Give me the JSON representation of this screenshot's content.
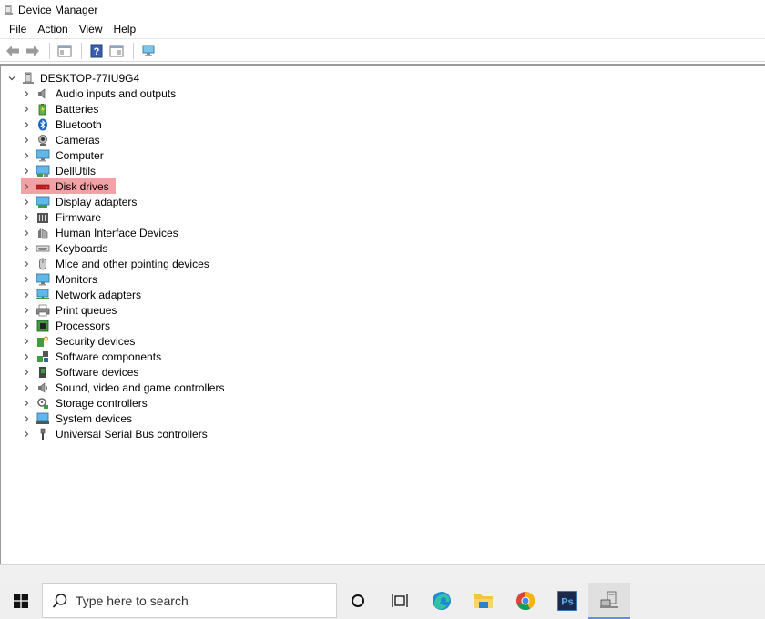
{
  "window": {
    "title": "Device Manager"
  },
  "menu": [
    {
      "label": "File"
    },
    {
      "label": "Action"
    },
    {
      "label": "View"
    },
    {
      "label": "Help"
    }
  ],
  "toolbar": {
    "buttons": [
      {
        "icon": "back-arrow-icon"
      },
      {
        "icon": "forward-arrow-icon"
      },
      {
        "icon": "properties-icon"
      },
      {
        "icon": "help-icon"
      },
      {
        "icon": "update-driver-icon"
      },
      {
        "icon": "scan-hardware-icon"
      }
    ]
  },
  "tree": {
    "root": {
      "label": "DESKTOP-77IU9G4",
      "icon": "computer-tower-icon"
    },
    "items": [
      {
        "label": "Audio inputs and outputs",
        "icon": "speaker-icon"
      },
      {
        "label": "Batteries",
        "icon": "battery-icon"
      },
      {
        "label": "Bluetooth",
        "icon": "bluetooth-icon"
      },
      {
        "label": "Cameras",
        "icon": "camera-icon"
      },
      {
        "label": "Computer",
        "icon": "monitor-icon"
      },
      {
        "label": "DellUtils",
        "icon": "network-monitor-icon"
      },
      {
        "label": "Disk drives",
        "icon": "disk-drive-icon",
        "selected": true
      },
      {
        "label": "Display adapters",
        "icon": "display-adapter-icon"
      },
      {
        "label": "Firmware",
        "icon": "firmware-icon"
      },
      {
        "label": "Human Interface Devices",
        "icon": "hid-icon"
      },
      {
        "label": "Keyboards",
        "icon": "keyboard-icon"
      },
      {
        "label": "Mice and other pointing devices",
        "icon": "mouse-icon"
      },
      {
        "label": "Monitors",
        "icon": "monitor-icon"
      },
      {
        "label": "Network adapters",
        "icon": "network-adapter-icon"
      },
      {
        "label": "Print queues",
        "icon": "printer-icon"
      },
      {
        "label": "Processors",
        "icon": "processor-icon"
      },
      {
        "label": "Security devices",
        "icon": "security-key-icon"
      },
      {
        "label": "Software components",
        "icon": "software-components-icon"
      },
      {
        "label": "Software devices",
        "icon": "software-device-icon"
      },
      {
        "label": "Sound, video and game controllers",
        "icon": "sound-icon"
      },
      {
        "label": "Storage controllers",
        "icon": "storage-controller-icon"
      },
      {
        "label": "System devices",
        "icon": "system-devices-icon"
      },
      {
        "label": "Universal Serial Bus controllers",
        "icon": "usb-icon"
      }
    ]
  },
  "taskbar": {
    "search_placeholder": "Type here to search",
    "apps": [
      {
        "icon": "cortana-icon"
      },
      {
        "icon": "task-view-icon"
      },
      {
        "icon": "edge-icon"
      },
      {
        "icon": "file-explorer-icon"
      },
      {
        "icon": "chrome-icon"
      },
      {
        "icon": "photoshop-icon",
        "label": "Ps"
      },
      {
        "icon": "device-manager-icon",
        "active": true
      }
    ]
  },
  "colors": {
    "selection": "#f4a1a6",
    "photoshop": "#1b2a4a",
    "accent": "#6a8fcf"
  }
}
